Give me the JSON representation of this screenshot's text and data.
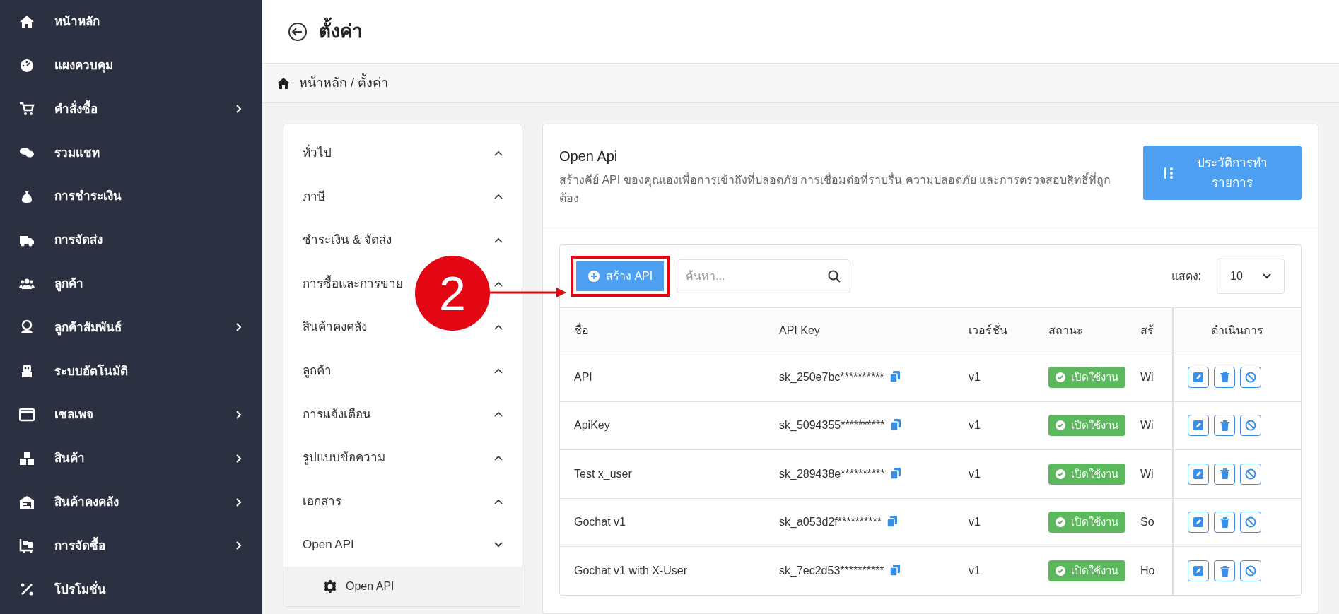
{
  "sidebar": {
    "items": [
      {
        "label": "หน้าหลัก",
        "has_submenu": false
      },
      {
        "label": "แผงควบคุม",
        "has_submenu": false
      },
      {
        "label": "คำสั่งซื้อ",
        "has_submenu": true
      },
      {
        "label": "รวมแชท",
        "has_submenu": false
      },
      {
        "label": "การชำระเงิน",
        "has_submenu": false
      },
      {
        "label": "การจัดส่ง",
        "has_submenu": false
      },
      {
        "label": "ลูกค้า",
        "has_submenu": false
      },
      {
        "label": "ลูกค้าสัมพันธ์",
        "has_submenu": true
      },
      {
        "label": "ระบบอัตโนมัติ",
        "has_submenu": false
      },
      {
        "label": "เซลเพจ",
        "has_submenu": true
      },
      {
        "label": "สินค้า",
        "has_submenu": true
      },
      {
        "label": "สินค้าคงคลัง",
        "has_submenu": true
      },
      {
        "label": "การจัดซื้อ",
        "has_submenu": true
      },
      {
        "label": "โปรโมชั่น",
        "has_submenu": false
      }
    ]
  },
  "header": {
    "title": "ตั้งค่า"
  },
  "breadcrumb": "หน้าหลัก / ตั้งค่า",
  "settings_menu": [
    {
      "label": "ทั่วไป",
      "expanded": false
    },
    {
      "label": "ภาษี",
      "expanded": false
    },
    {
      "label": "ชำระเงิน & จัดส่ง",
      "expanded": false
    },
    {
      "label": "การซื้อและการขาย",
      "expanded": false
    },
    {
      "label": "สินค้าคงคลัง",
      "expanded": false
    },
    {
      "label": "ลูกค้า",
      "expanded": false
    },
    {
      "label": "การแจ้งเตือน",
      "expanded": false
    },
    {
      "label": "รูปแบบข้อความ",
      "expanded": false
    },
    {
      "label": "เอกสาร",
      "expanded": false
    },
    {
      "label": "Open API",
      "expanded": true,
      "children": [
        {
          "label": "Open API",
          "selected": true
        }
      ]
    }
  ],
  "panel": {
    "title": "Open Api",
    "description": "สร้างคีย์ API ของคุณเองเพื่อการเข้าถึงที่ปลอดภัย การเชื่อมต่อที่ราบรื่น ความปลอดภัย และการตรวจสอบสิทธิ์ที่ถูกต้อง",
    "history_button": "ประวัติการทำรายการ"
  },
  "toolbar": {
    "create_button": "สร้าง API",
    "search": {
      "placeholder": "ค้นหา..."
    },
    "show_label": "แสดง:",
    "page_size": "10"
  },
  "annotation": {
    "step": "2"
  },
  "table": {
    "columns": [
      "ชื่อ",
      "API Key",
      "เวอร์ชั่น",
      "สถานะ",
      "สร้",
      "ดำเนินการ"
    ],
    "rows": [
      {
        "name": "API",
        "api_key": "sk_250e7bc**********",
        "version": "v1",
        "status": "เปิดใช้งาน",
        "enabled": true,
        "column_5": "Wi"
      },
      {
        "name": "ApiKey",
        "api_key": "sk_5094355**********",
        "version": "v1",
        "status": "เปิดใช้งาน",
        "enabled": true,
        "column_5": "Wi"
      },
      {
        "name": "Test x_user",
        "api_key": "sk_289438e**********",
        "version": "v1",
        "status": "เปิดใช้งาน",
        "enabled": true,
        "column_5": "Wi"
      },
      {
        "name": "Gochat v1",
        "api_key": "sk_a053d2f**********",
        "version": "v1",
        "status": "เปิดใช้งาน",
        "enabled": true,
        "column_5": "So"
      },
      {
        "name": "Gochat v1 with X-User",
        "api_key": "sk_7ec2d53**********",
        "version": "v1",
        "status": "เปิดใช้งาน",
        "enabled": true,
        "column_5": "Ho"
      }
    ]
  }
}
